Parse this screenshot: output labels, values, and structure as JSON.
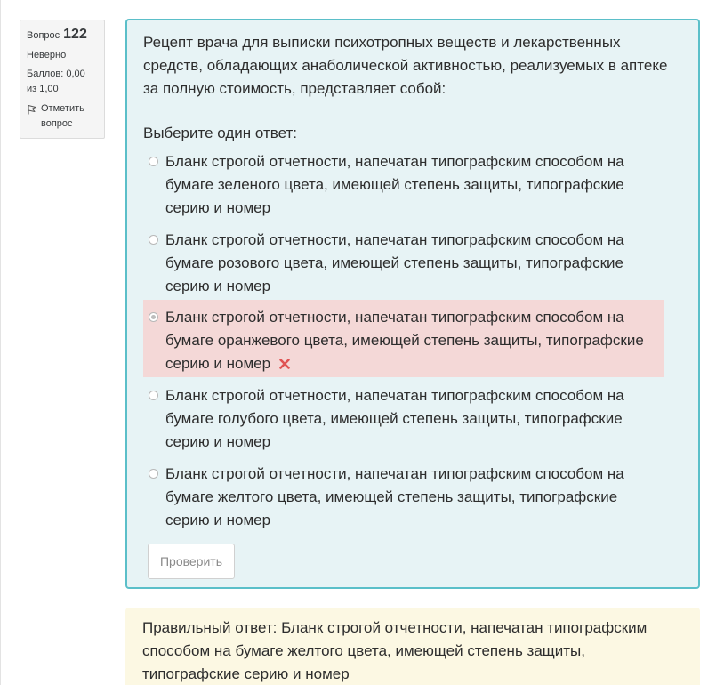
{
  "info": {
    "question_label": "Вопрос",
    "question_number": "122",
    "state": "Неверно",
    "grade": "Баллов: 0,00 из 1,00",
    "flag_label": "Отметить вопрос"
  },
  "question": {
    "text": "Рецепт врача для выписки психотропных веществ и лекарственных средств, обладающих анаболической активностью, реализуемых в аптеке за полную стоимость, представляет собой:",
    "prompt": "Выберите один ответ:",
    "answers": [
      {
        "text": "Бланк строгой отчетности, напечатан типографским способом на бумаге зеленого цвета, имеющей степень защиты, типографские серию и номер",
        "selected": false
      },
      {
        "text": "Бланк строгой отчетности, напечатан типографским способом на бумаге розового цвета, имеющей степень защиты, типографские серию и номер",
        "selected": false
      },
      {
        "text": "Бланк строгой отчетности, напечатан типографским способом на бумаге оранжевого цвета, имеющей степень защиты, типографские серию и номер",
        "selected": true,
        "status": "incorrect"
      },
      {
        "text": "Бланк строгой отчетности, напечатан типографским способом на бумаге голубого цвета, имеющей степень защиты, типографские серию и номер",
        "selected": false
      },
      {
        "text": "Бланк строгой отчетности, напечатан типографским способом на бумаге желтого цвета, имеющей степень защиты, типографские серию и номер",
        "selected": false
      }
    ],
    "check_button_label": "Проверить"
  },
  "feedback": {
    "correct_answer": "Правильный ответ: Бланк строгой отчетности, напечатан типографским способом на бумаге желтого цвета, имеющей степень защиты, типографские серию и номер"
  },
  "icons": {
    "flag": "flag-icon",
    "incorrect": "cross-icon"
  },
  "colors": {
    "content_border": "#5bbfc9",
    "content_background": "#e7f3f5",
    "incorrect_background": "#f4d8d7",
    "feedback_background": "#fcf8e3",
    "incorrect_icon": "#e05252"
  }
}
